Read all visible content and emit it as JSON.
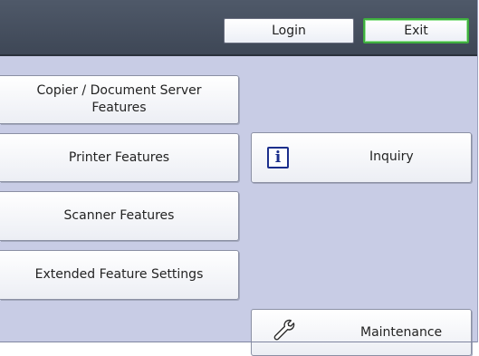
{
  "topbar": {
    "login_label": "Login",
    "exit_label": "Exit"
  },
  "features": [
    {
      "label": "Copier / Document Server\nFeatures"
    },
    {
      "label": "Printer Features"
    },
    {
      "label": "Scanner Features"
    },
    {
      "label": "Extended Feature Settings"
    }
  ],
  "actions": {
    "inquiry_label": "Inquiry",
    "maintenance_label": "Maintenance"
  },
  "icons": {
    "inquiry": "info-icon",
    "maintenance": "wrench-icon"
  },
  "colors": {
    "panel_bg": "#c8cce5",
    "topbar_bg": "#4b5566",
    "exit_border": "#3fae3f"
  }
}
